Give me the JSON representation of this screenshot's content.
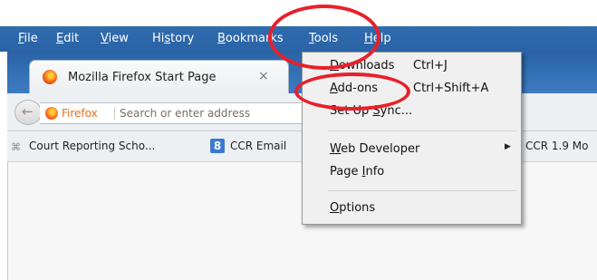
{
  "menubar": {
    "items": [
      {
        "u": "F",
        "rest": "ile"
      },
      {
        "u": "E",
        "rest": "dit"
      },
      {
        "u": "V",
        "rest": "iew"
      },
      {
        "pre": "Hi",
        "u": "s",
        "rest": "tory"
      },
      {
        "u": "B",
        "rest": "ookmarks"
      },
      {
        "u": "T",
        "rest": "ools"
      },
      {
        "u": "H",
        "rest": "elp"
      }
    ]
  },
  "tab": {
    "title": "Mozilla Firefox Start Page",
    "close": "×"
  },
  "navbar": {
    "back_glyph": "←",
    "identity_label": "Firefox",
    "url_placeholder": "Search or enter address"
  },
  "bookmarks": {
    "items": [
      "Court Reporting Scho...",
      "CCR Email",
      "CCR 1.9 Mo"
    ],
    "icon2_letter": "8"
  },
  "tools_menu": {
    "items": [
      {
        "pre": "",
        "u": "D",
        "rest": "ownloads",
        "shortcut": "Ctrl+J"
      },
      {
        "pre": "",
        "u": "A",
        "rest": "dd-ons",
        "shortcut": "Ctrl+Shift+A"
      },
      {
        "pre": "Set Up ",
        "u": "S",
        "rest": "ync...",
        "shortcut": ""
      },
      {
        "pre": "",
        "u": "W",
        "rest": "eb Developer",
        "shortcut": ""
      },
      {
        "pre": "Page ",
        "u": "I",
        "rest": "nfo",
        "shortcut": ""
      },
      {
        "pre": "",
        "u": "O",
        "rest": "ptions",
        "shortcut": ""
      }
    ],
    "submenu_arrow": "▶"
  },
  "colors": {
    "highlight_ring": "#e8202a",
    "menubar": "#2f6cb0",
    "firefox_orange": "#e6711d"
  }
}
